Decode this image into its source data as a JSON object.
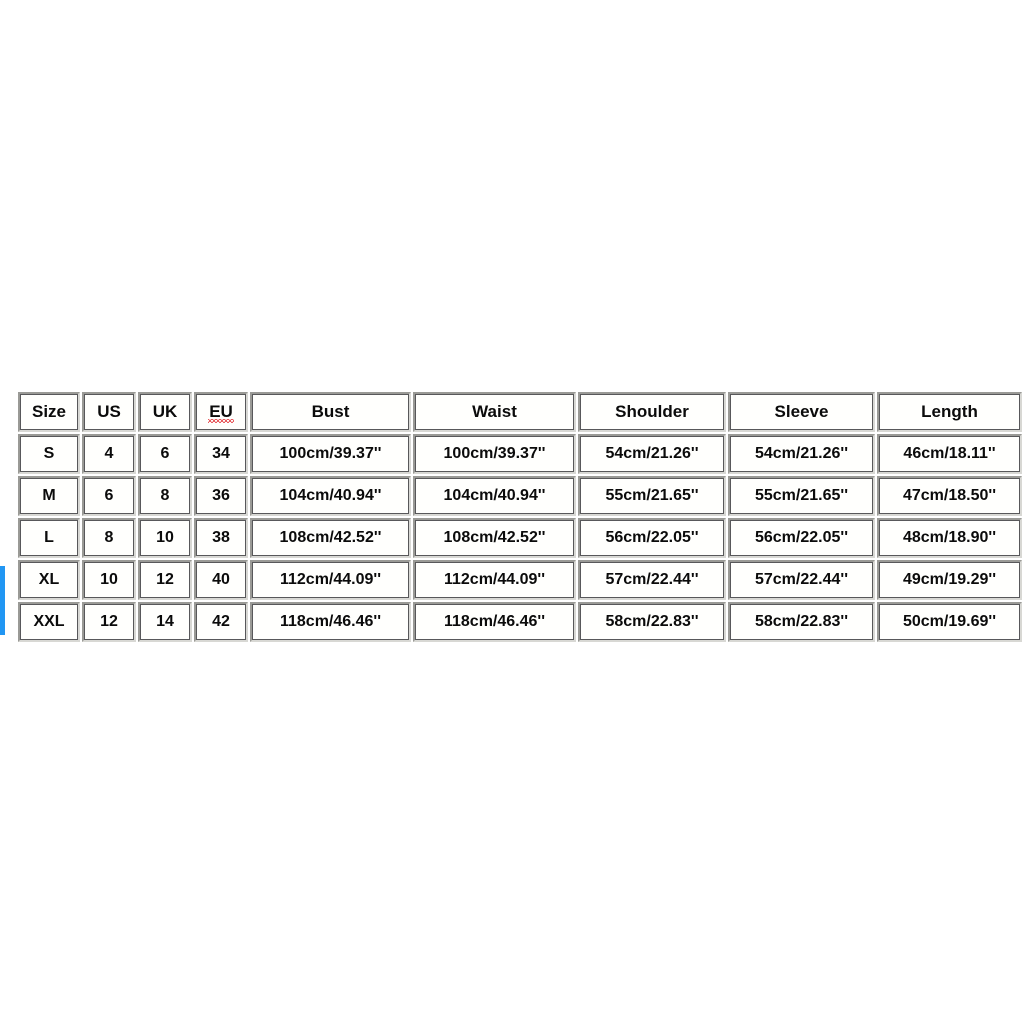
{
  "page": {
    "background_color": "#ffffff",
    "edge_artifact_color": "#2196f3"
  },
  "size_chart": {
    "columns": [
      "Size",
      "US",
      "UK",
      "EU",
      "Bust",
      "Waist",
      "Shoulder",
      "Sleeve",
      "Length"
    ],
    "eu_header_has_spellcheck_underline": true,
    "rows": [
      {
        "size": "S",
        "us": "4",
        "uk": "6",
        "eu": "34",
        "bust": "100cm/39.37''",
        "waist": "100cm/39.37''",
        "shoulder": "54cm/21.26''",
        "sleeve": "54cm/21.26''",
        "length": "46cm/18.11''"
      },
      {
        "size": "M",
        "us": "6",
        "uk": "8",
        "eu": "36",
        "bust": "104cm/40.94''",
        "waist": "104cm/40.94''",
        "shoulder": "55cm/21.65''",
        "sleeve": "55cm/21.65''",
        "length": "47cm/18.50''"
      },
      {
        "size": "L",
        "us": "8",
        "uk": "10",
        "eu": "38",
        "bust": "108cm/42.52''",
        "waist": "108cm/42.52''",
        "shoulder": "56cm/22.05''",
        "sleeve": "56cm/22.05''",
        "length": "48cm/18.90''"
      },
      {
        "size": "XL",
        "us": "10",
        "uk": "12",
        "eu": "40",
        "bust": "112cm/44.09''",
        "waist": "112cm/44.09''",
        "shoulder": "57cm/22.44''",
        "sleeve": "57cm/22.44''",
        "length": "49cm/19.29''"
      },
      {
        "size": "XXL",
        "us": "12",
        "uk": "14",
        "eu": "42",
        "bust": "118cm/46.46''",
        "waist": "118cm/46.46''",
        "shoulder": "58cm/22.83''",
        "sleeve": "58cm/22.83''",
        "length": "50cm/19.69''"
      }
    ]
  }
}
